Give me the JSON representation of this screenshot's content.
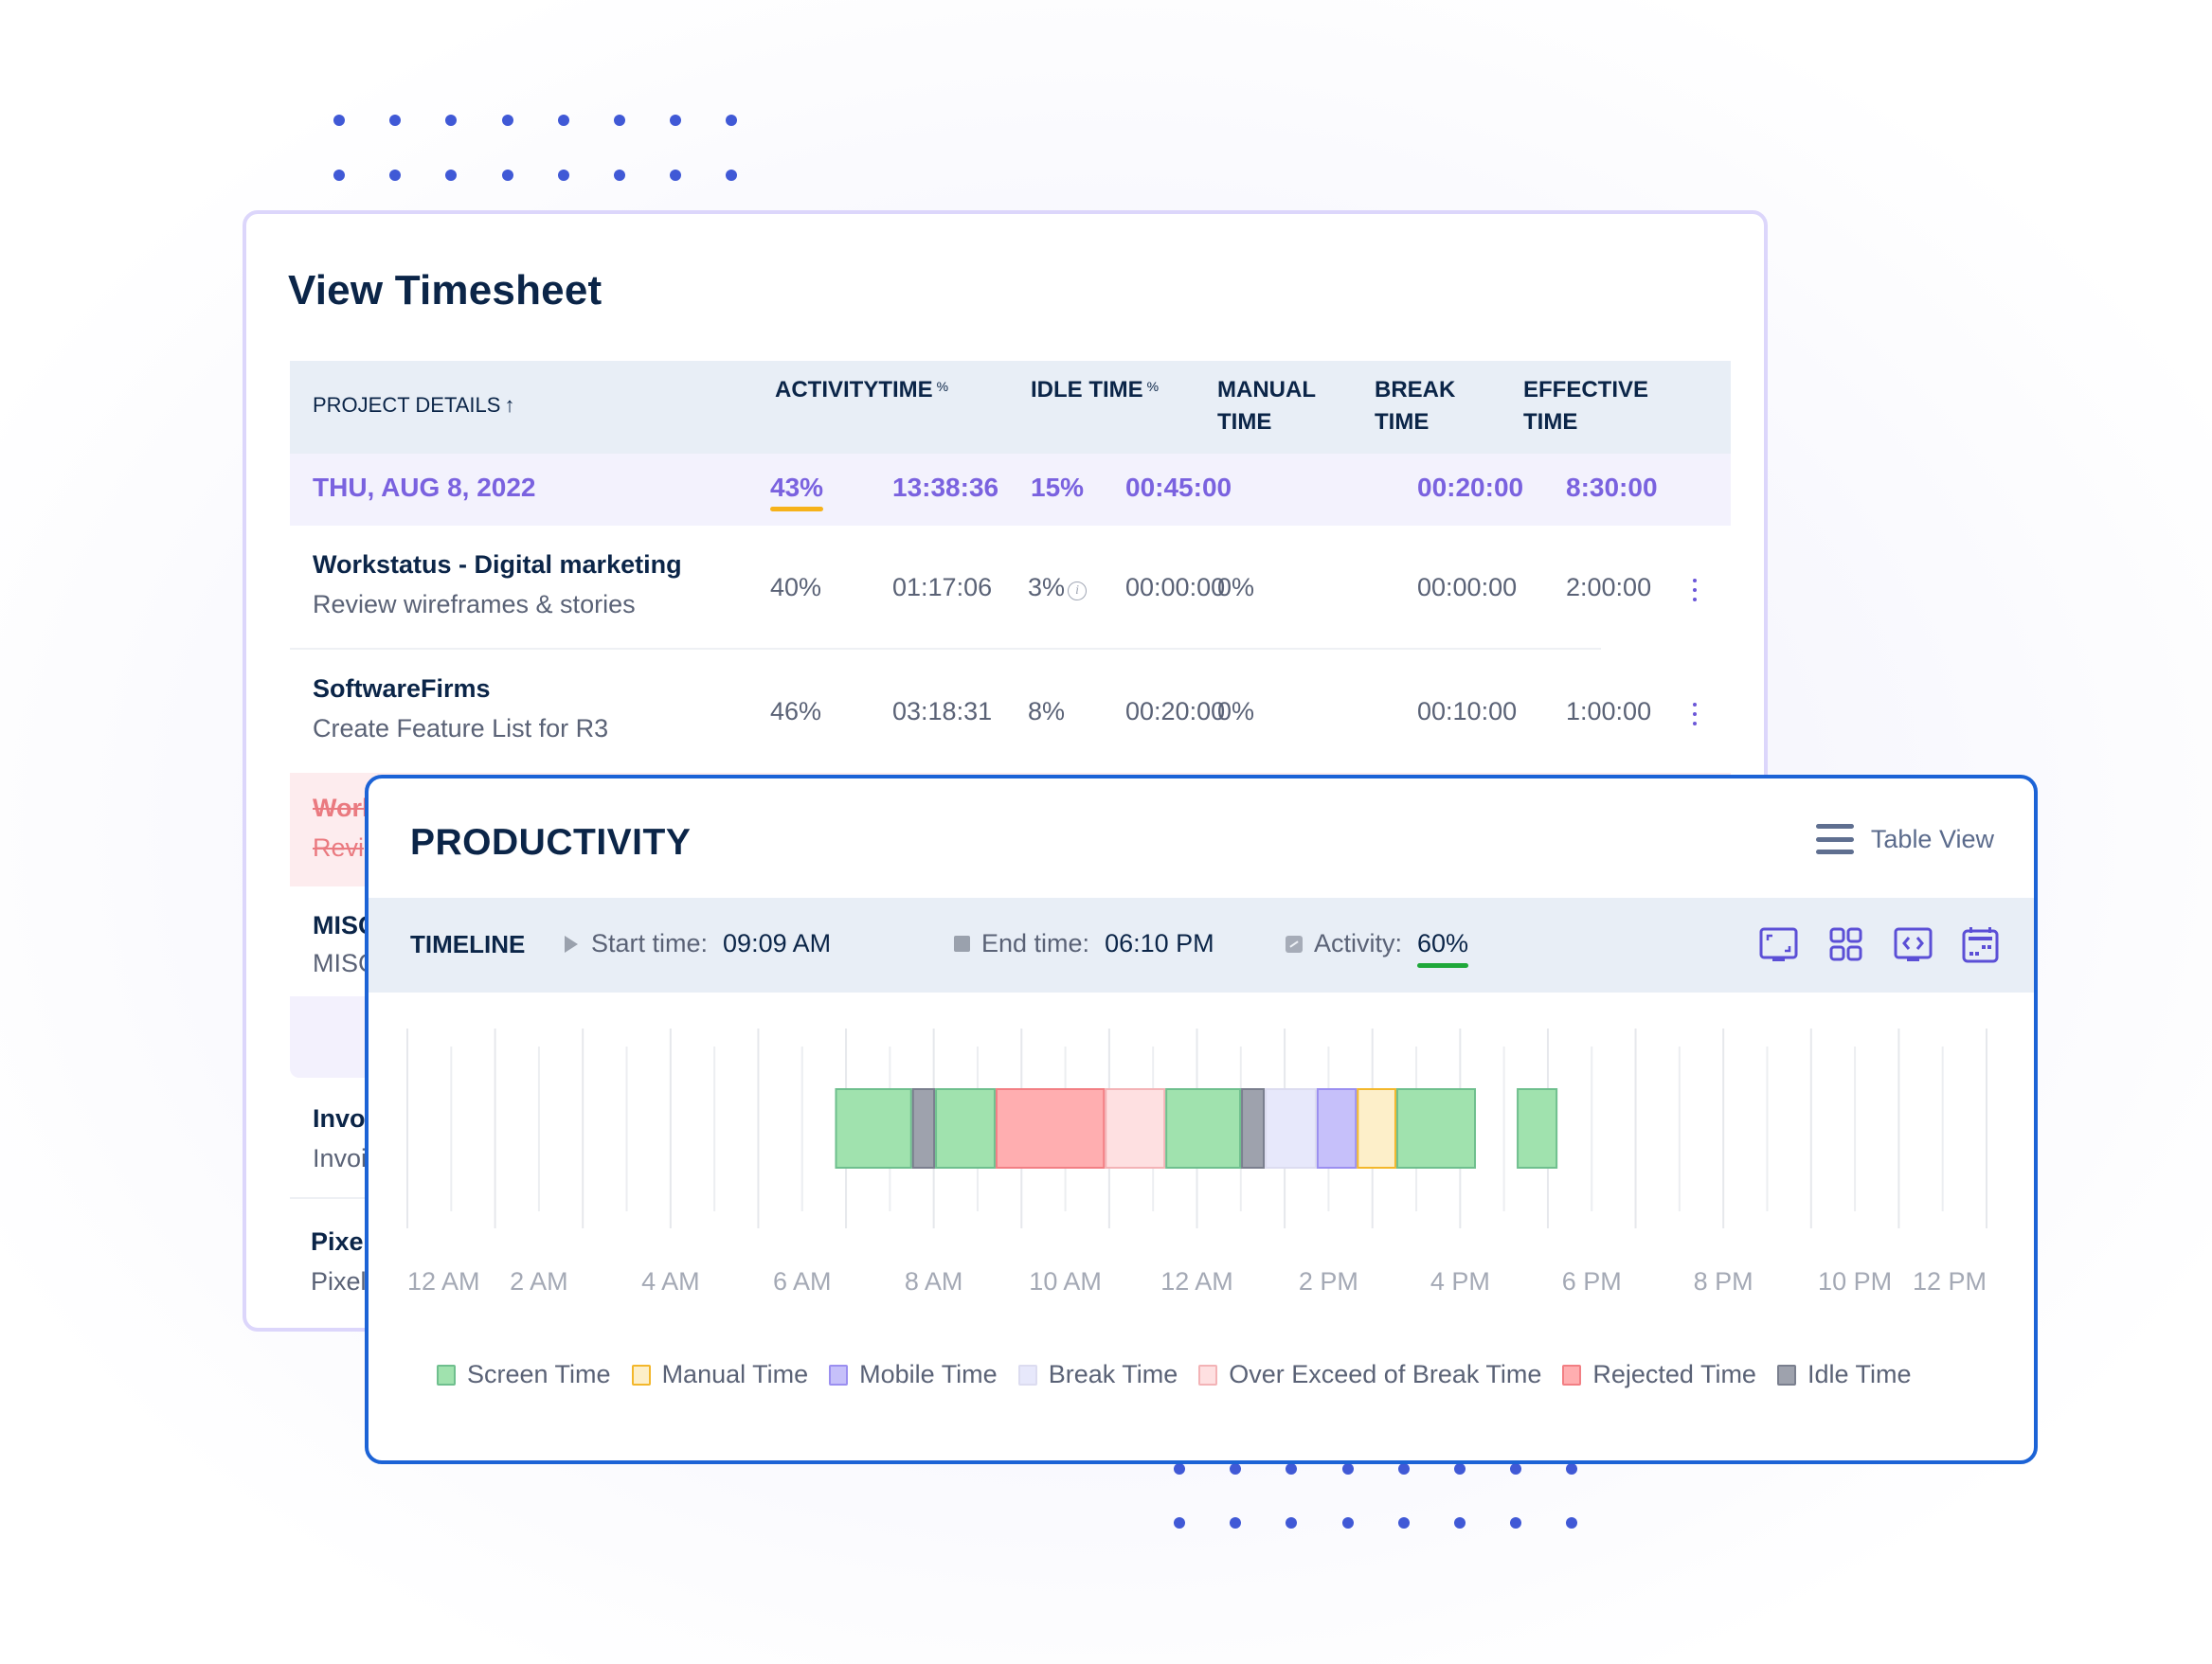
{
  "timesheet": {
    "title": "View Timesheet",
    "columns": {
      "project_details": "PROJECT DETAILS",
      "sort_icon": "arrow-up-icon",
      "activity": "ACTIVITY",
      "time": "TIME",
      "percent_symbol": "%",
      "idle_time": "IDLE TIME",
      "manual_time_line1": "MANUAL",
      "manual_time_line2": "TIME",
      "break_time_line1": "BREAK",
      "break_time_line2": "TIME",
      "effective_time_line1": "EFFECTIVE",
      "effective_time_line2": "TIME"
    },
    "date_row": {
      "date": "THU, AUG 8, 2022",
      "activity_pct": "43%",
      "time": "13:38:36",
      "idle_pct": "15%",
      "idle_time": "00:45:00",
      "manual_time": "",
      "break_time": "00:20:00",
      "effective_time": "8:30:00",
      "accent_color": "#7a62df",
      "activity_underline_color": "#f6b21a"
    },
    "rows": [
      {
        "project": "Workstatus - Digital marketing",
        "task": "Review wireframes & stories",
        "activity_pct": "40%",
        "time": "01:17:06",
        "idle_pct": "3%",
        "idle_info_icon": "info-icon",
        "idle_time": "00:00:00",
        "manual_pct": "0%",
        "break_time": "00:00:00",
        "effective_time": "2:00:00",
        "status": "normal"
      },
      {
        "project": "SoftwareFirms",
        "task": "Create Feature List for R3",
        "activity_pct": "46%",
        "time": "03:18:31",
        "idle_pct": "8%",
        "idle_time": "00:20:00",
        "manual_pct": "0%",
        "break_time": "00:10:00",
        "effective_time": "1:00:00",
        "status": "normal"
      },
      {
        "project": "Work",
        "task": "Revi",
        "status": "rejected"
      },
      {
        "project": "MISC",
        "task": "MISC",
        "status": "normal"
      },
      {
        "project": "Invo",
        "task": "Invoi",
        "status": "normal"
      },
      {
        "project": "Pixel",
        "task": "Pixel",
        "status": "normal"
      }
    ]
  },
  "productivity": {
    "title": "PRODUCTIVITY",
    "table_view_label": "Table View",
    "timeline": {
      "label": "TIMELINE",
      "start_label": "Start time:",
      "start_value": "09:09 AM",
      "end_label": "End time:",
      "end_value": "06:10 PM",
      "activity_label": "Activity:",
      "activity_value": "60%",
      "activity_underline_color": "#1fa83a"
    },
    "tool_icons": [
      "fullscreen-icon",
      "grid-view-icon",
      "code-screen-icon",
      "calendar-icon"
    ],
    "icon_color": "#5b4fd6"
  },
  "chart_data": {
    "type": "bar",
    "subtype": "timeline",
    "title": "",
    "xlabel": "",
    "ylabel": "",
    "x_range_hours": [
      0,
      24
    ],
    "x_tick_labels": [
      "12 AM",
      "2 AM",
      "4 AM",
      "6 AM",
      "8 AM",
      "10 AM",
      "12 AM",
      "2 PM",
      "4 PM",
      "6 PM",
      "8 PM",
      "10 PM",
      "12 PM"
    ],
    "grid": true,
    "legend_position": "bottom",
    "categories": {
      "screen": {
        "name": "Screen Time",
        "fill": "#a0e2ae",
        "stroke": "#6fbf8e"
      },
      "manual": {
        "name": "Manual Time",
        "fill": "#fdefc9",
        "stroke": "#f3b72b"
      },
      "mobile": {
        "name": "Mobile Time",
        "fill": "#c6c0fa",
        "stroke": "#9b8ff0"
      },
      "break": {
        "name": "Break Time",
        "fill": "#e7e8fb",
        "stroke": "#dcdcf0"
      },
      "over_break": {
        "name": "Over Exceed of Break Time",
        "fill": "#fee0e1",
        "stroke": "#f3b3b6"
      },
      "rejected": {
        "name": "Rejected Time",
        "fill": "#ffaeb0",
        "stroke": "#f27f84"
      },
      "idle": {
        "name": "Idle Time",
        "fill": "#9ea2ad",
        "stroke": "#7a7f8e"
      }
    },
    "legend_order": [
      "screen",
      "manual",
      "mobile",
      "break",
      "over_break",
      "rejected",
      "idle"
    ],
    "segments": [
      {
        "type": "screen",
        "start": 6.5,
        "end": 7.67
      },
      {
        "type": "idle",
        "start": 7.67,
        "end": 8.02
      },
      {
        "type": "screen",
        "start": 8.02,
        "end": 8.94
      },
      {
        "type": "rejected",
        "start": 8.94,
        "end": 10.6
      },
      {
        "type": "over_break",
        "start": 10.6,
        "end": 11.52
      },
      {
        "type": "screen",
        "start": 11.52,
        "end": 12.67
      },
      {
        "type": "idle",
        "start": 12.67,
        "end": 13.03
      },
      {
        "type": "break",
        "start": 13.03,
        "end": 13.82
      },
      {
        "type": "mobile",
        "start": 13.82,
        "end": 14.43
      },
      {
        "type": "manual",
        "start": 14.43,
        "end": 15.03
      },
      {
        "type": "screen",
        "start": 15.03,
        "end": 16.24
      },
      {
        "type": "screen",
        "start": 16.86,
        "end": 17.48
      }
    ]
  }
}
